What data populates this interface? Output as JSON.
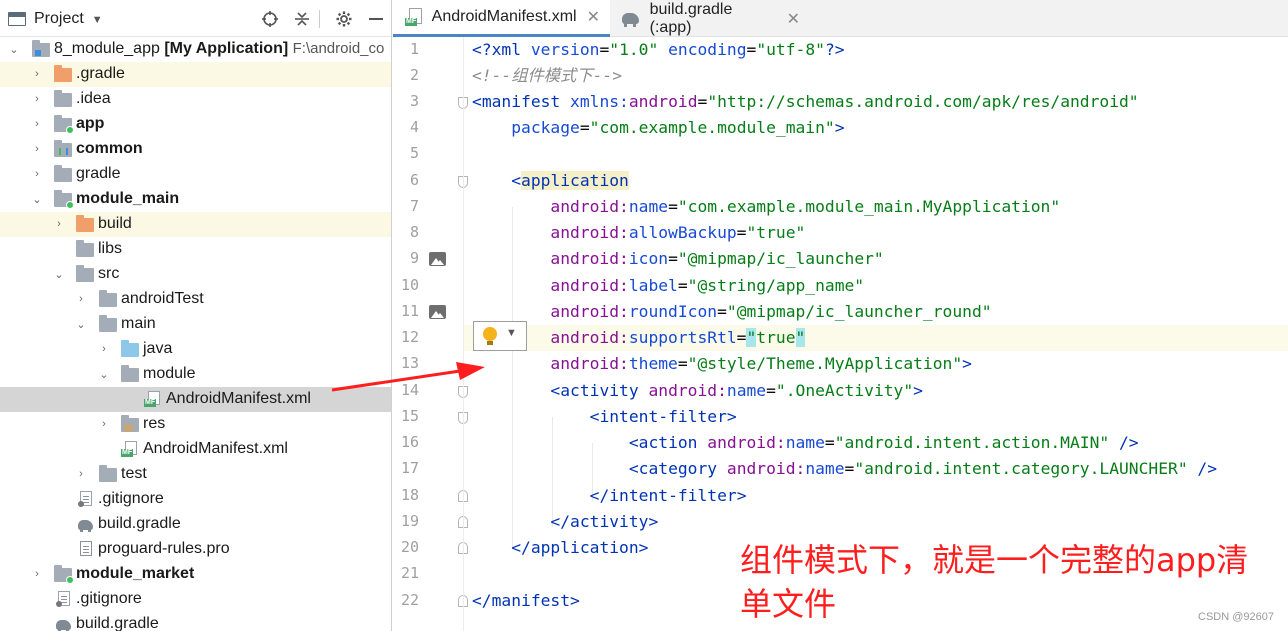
{
  "project_panel": {
    "title": "Project",
    "tree": [
      {
        "label": "8_module_app",
        "suffix": "[My Application]",
        "path": "F:\\android_co",
        "bold_main": false
      },
      {
        "label": ".gradle"
      },
      {
        "label": ".idea"
      },
      {
        "label": "app"
      },
      {
        "label": "common"
      },
      {
        "label": "gradle"
      },
      {
        "label": "module_main"
      },
      {
        "label": "build"
      },
      {
        "label": "libs"
      },
      {
        "label": "src"
      },
      {
        "label": "androidTest"
      },
      {
        "label": "main"
      },
      {
        "label": "java"
      },
      {
        "label": "module"
      },
      {
        "label": "AndroidManifest.xml"
      },
      {
        "label": "res"
      },
      {
        "label": "AndroidManifest.xml"
      },
      {
        "label": "test"
      },
      {
        "label": ".gitignore"
      },
      {
        "label": "build.gradle"
      },
      {
        "label": "proguard-rules.pro"
      },
      {
        "label": "module_market"
      },
      {
        "label": ".gitignore"
      },
      {
        "label": "build.gradle"
      }
    ],
    "file_badge": "MF"
  },
  "editor": {
    "tabs": [
      {
        "label": "AndroidManifest.xml"
      },
      {
        "label": "build.gradle (:app)"
      }
    ],
    "line_numbers": [
      "1",
      "2",
      "3",
      "4",
      "5",
      "6",
      "7",
      "8",
      "9",
      "10",
      "11",
      "12",
      "13",
      "14",
      "15",
      "16",
      "17",
      "18",
      "19",
      "20",
      "21",
      "22"
    ]
  },
  "code": {
    "l1": {
      "a": "<?",
      "b": "xml ",
      "c": "version",
      "d": "=",
      "e": "\"1.0\" ",
      "f": "encoding",
      "g": "=",
      "h": "\"utf-8\"",
      "i": "?>"
    },
    "l2": "<!--组件模式下-->",
    "l3": {
      "open": "<",
      "tag": "manifest ",
      "ns": "xmlns:",
      "attr": "android",
      "eq": "=",
      "val": "\"http://schemas.android.com/apk/res/android\""
    },
    "l4": {
      "attr": "package",
      "eq": "=",
      "val": "\"com.example.module_main\"",
      "close": ">"
    },
    "l6": {
      "open": "<",
      "tag": "application",
      "close": ""
    },
    "l7": {
      "ns": "android:",
      "attr": "name",
      "eq": "=",
      "val": "\"com.example.module_main.MyApplication\""
    },
    "l8": {
      "ns": "android:",
      "attr": "allowBackup",
      "eq": "=",
      "val": "\"true\""
    },
    "l9": {
      "ns": "android:",
      "attr": "icon",
      "eq": "=",
      "val": "\"@mipmap/ic_launcher\""
    },
    "l10": {
      "ns": "android:",
      "attr": "label",
      "eq": "=",
      "val": "\"@string/app_name\""
    },
    "l11": {
      "ns": "android:",
      "attr": "roundIcon",
      "eq": "=",
      "val": "\"@mipmap/ic_launcher_round\""
    },
    "l12": {
      "ns": "android:",
      "attr": "supportsRtl",
      "eq": "=",
      "q1": "\"",
      "val": "true",
      "q2": "\""
    },
    "l13": {
      "ns": "android:",
      "attr": "theme",
      "eq": "=",
      "val": "\"@style/Theme.MyApplication\"",
      "close": ">"
    },
    "l14": {
      "open": "<",
      "tag": "activity ",
      "ns": "android:",
      "attr": "name",
      "eq": "=",
      "val": "\".OneActivity\"",
      "close": ">"
    },
    "l15": {
      "open": "<",
      "tag": "intent-filter",
      "close": ">"
    },
    "l16": {
      "open": "<",
      "tag": "action ",
      "ns": "android:",
      "attr": "name",
      "eq": "=",
      "val": "\"android.intent.action.MAIN\"",
      "close": " />"
    },
    "l17": {
      "open": "<",
      "tag": "category ",
      "ns": "android:",
      "attr": "name",
      "eq": "=",
      "val": "\"android.intent.category.LAUNCHER\"",
      "close": " />"
    },
    "l18": {
      "open": "</",
      "tag": "intent-filter",
      "close": ">"
    },
    "l19": {
      "open": "</",
      "tag": "activity",
      "close": ">"
    },
    "l20": {
      "open": "</",
      "tag": "application",
      "close": ">"
    },
    "l22": {
      "open": "</",
      "tag": "manifest",
      "close": ">"
    }
  },
  "annotation": {
    "text": "组件模式下，就是一个完整的app清单文件"
  },
  "watermark": "CSDN @92607",
  "colors": {
    "annotation": "#ff1e1e",
    "selection": "#d5d5d5",
    "highlight_row": "#fbf8e3",
    "tab_underline": "#4a86c7"
  }
}
